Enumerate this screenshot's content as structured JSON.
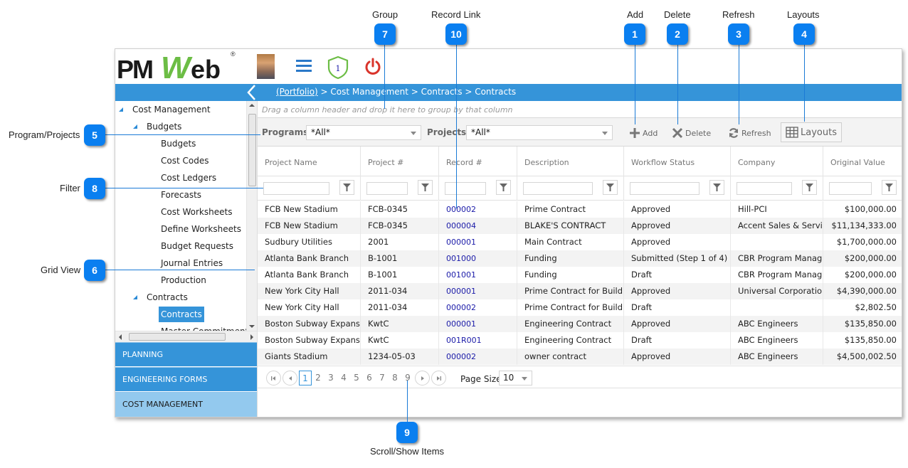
{
  "annotations": [
    {
      "number": "7",
      "label": "Group"
    },
    {
      "number": "10",
      "label": "Record Link"
    },
    {
      "number": "1",
      "label": "Add"
    },
    {
      "number": "2",
      "label": "Delete"
    },
    {
      "number": "3",
      "label": "Refresh"
    },
    {
      "number": "4",
      "label": "Layouts"
    },
    {
      "number": "5",
      "label": "Program/Projects"
    },
    {
      "number": "8",
      "label": "Filter"
    },
    {
      "number": "6",
      "label": "Grid View"
    },
    {
      "number": "9",
      "label": "Scroll/Show Items"
    }
  ],
  "header": {
    "logo": {
      "pm": "PM",
      "w": "W",
      "eb": "eb",
      "reg": "®"
    },
    "notification_count": "1",
    "icons": [
      "user-avatar",
      "hamburger-menu-icon",
      "shield-notification-icon",
      "power-icon"
    ]
  },
  "breadcrumb": {
    "root": "(Portfolio)",
    "rest": " > Cost Management > Contracts > Contracts"
  },
  "sidebar": {
    "tree": [
      {
        "label": "Cost Management",
        "level": 0,
        "expanded": true
      },
      {
        "label": "Budgets",
        "level": 1,
        "expanded": true
      },
      {
        "label": "Budgets",
        "level": 2
      },
      {
        "label": "Cost Codes",
        "level": 2
      },
      {
        "label": "Cost Ledgers",
        "level": 2
      },
      {
        "label": "Forecasts",
        "level": 2
      },
      {
        "label": "Cost Worksheets",
        "level": 2
      },
      {
        "label": "Define Worksheets",
        "level": 2
      },
      {
        "label": "Budget Requests",
        "level": 2
      },
      {
        "label": "Journal Entries",
        "level": 2
      },
      {
        "label": "Production",
        "level": 2
      },
      {
        "label": "Contracts",
        "level": 1,
        "expanded": true
      },
      {
        "label": "Contracts",
        "level": 2,
        "selected": true
      },
      {
        "label": "Master Commitments",
        "level": 2
      }
    ],
    "modules": [
      {
        "label": "PLANNING",
        "active": false
      },
      {
        "label": "ENGINEERING FORMS",
        "active": false
      },
      {
        "label": "COST MANAGEMENT",
        "active": true
      }
    ]
  },
  "main": {
    "group_hint": "Drag a column header and drop it here to group by that column",
    "toolbar": {
      "programs_label": "Programs",
      "programs_value": "*All*",
      "projects_label": "Projects",
      "projects_value": "*All*",
      "add_label": "Add",
      "delete_label": "Delete",
      "refresh_label": "Refresh",
      "layouts_label": "Layouts"
    },
    "grid": {
      "columns": [
        "Project Name",
        "Project #",
        "Record #",
        "Description",
        "Workflow Status",
        "Company",
        "Original Value"
      ],
      "rows": [
        [
          "FCB New Stadium",
          "FCB-0345",
          "000002",
          "Prime Contract",
          "Approved",
          "Hill-PCI",
          "$100,000.00"
        ],
        [
          "FCB New Stadium",
          "FCB-0345",
          "000004",
          "BLAKE'S CONTRACT",
          "Approved",
          "Accent Sales & Service",
          "$11,134,333.00"
        ],
        [
          "Sudbury Utilities",
          "2001",
          "000001",
          "Main Contract",
          "Approved",
          "",
          "$1,700,000.00"
        ],
        [
          "Atlanta Bank Branch",
          "B-1001",
          "001000",
          "Funding",
          "Submitted (Step 1 of 4)",
          "CBR Program Manager",
          "$200,000.00"
        ],
        [
          "Atlanta Bank Branch",
          "B-1001",
          "001001",
          "Funding",
          "Draft",
          "CBR Program Manager",
          "$200,000.00"
        ],
        [
          "New York City Hall",
          "2011-034",
          "000001",
          "Prime Contract for Building",
          "Approved",
          "Universal Corporation",
          "$4,390,000.00"
        ],
        [
          "New York City Hall",
          "2011-034",
          "000002",
          "Prime Contract for Building",
          "Draft",
          "",
          "$2,802.50"
        ],
        [
          "Boston Subway Expansion",
          "KwtC",
          "000001",
          "Engineering Contract",
          "Approved",
          "ABC Engineers",
          "$135,850.00"
        ],
        [
          "Boston Subway Expansion",
          "KwtC",
          "001R001",
          "Engineering Contract",
          "Draft",
          "ABC Engineers",
          "$135,850.00"
        ],
        [
          "Giants Stadium",
          "1234-05-03",
          "000002",
          "owner contract",
          "Approved",
          "ABC Engineers",
          "$4,500,002.50"
        ]
      ]
    },
    "pager": {
      "pages": [
        "1",
        "2",
        "3",
        "4",
        "5",
        "6",
        "7",
        "8",
        "9"
      ],
      "current_page": "1",
      "page_size_label": "Page Size",
      "page_size_value": "10"
    }
  },
  "colors": {
    "accent": "#3594d9",
    "callout": "#0a7ff0",
    "link": "#1a1aa8",
    "logo_green": "#6cbd45",
    "power_red": "#d9342b",
    "shield_green": "#6cbd45"
  }
}
